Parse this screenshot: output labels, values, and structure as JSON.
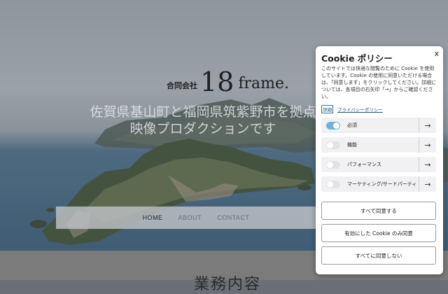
{
  "hero": {
    "logo_company": "合同会社",
    "logo_number": "18",
    "logo_word": "frame.",
    "tagline_line1": "佐賀県基山町と福岡県筑紫野市を拠点",
    "tagline_line2": "映像プロダクションです"
  },
  "nav": {
    "home": "HOME",
    "about": "ABOUT",
    "contact": "CONTACT"
  },
  "section": {
    "heading": "業務内容"
  },
  "cookie": {
    "title": "Cookie ポリシー",
    "close": "x",
    "description": "このサイトでは快適な閲覧のために Cookie を使用しています。Cookie の使用に同意いただける場合は、「同意します」をクリックしてください。詳細については、各項目の右矢印「→」からご確認ください。",
    "details_link": "詳細",
    "privacy_link": "プライバシーポリシー",
    "categories": [
      {
        "label": "必須",
        "enabled": true
      },
      {
        "label": "機能",
        "enabled": false
      },
      {
        "label": "パフォーマンス",
        "enabled": false
      },
      {
        "label": "マーケティング/サードパーティ",
        "enabled": false
      }
    ],
    "accept_all": "すべて同意する",
    "accept_selected": "有効にした Cookie のみ同意",
    "reject_all": "すべてに同意しない"
  },
  "colors": {
    "toggle_on": "#6fb4cf",
    "link": "#1e4f87"
  }
}
